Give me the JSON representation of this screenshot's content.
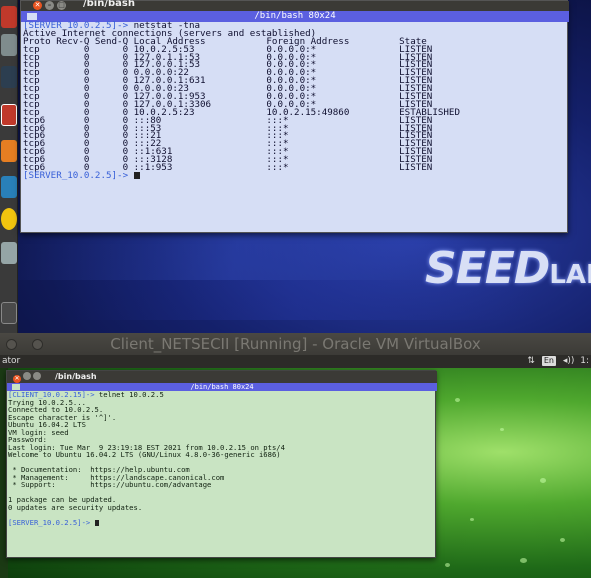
{
  "top_vm": {
    "window_title": "/bin/bash",
    "terminal_title": "/bin/bash 80x24",
    "logo": {
      "main": "SEED",
      "tail": "LAB"
    },
    "lines": [
      {
        "prompt": "[SERVER_10.0.2.5]->",
        "text": " netstat -tna"
      },
      {
        "text": "Active Internet connections (servers and established)"
      },
      {
        "text": "Proto Recv-Q Send-Q Local Address           Foreign Address         State"
      },
      {
        "text": "tcp        0      0 10.0.2.5:53             0.0.0.0:*               LISTEN"
      },
      {
        "text": "tcp        0      0 127.0.1.1:53            0.0.0.0:*               LISTEN"
      },
      {
        "text": "tcp        0      0 127.0.0.1:53            0.0.0.0:*               LISTEN"
      },
      {
        "text": "tcp        0      0 0.0.0.0:22              0.0.0.0:*               LISTEN"
      },
      {
        "text": "tcp        0      0 127.0.0.1:631           0.0.0.0:*               LISTEN"
      },
      {
        "text": "tcp        0      0 0.0.0.0:23              0.0.0.0:*               LISTEN"
      },
      {
        "text": "tcp        0      0 127.0.0.1:953           0.0.0.0:*               LISTEN"
      },
      {
        "text": "tcp        0      0 127.0.0.1:3306          0.0.0.0:*               LISTEN"
      },
      {
        "text": "tcp        0      0 10.0.2.5:23             10.0.2.15:49860         ESTABLISHED"
      },
      {
        "text": "tcp6       0      0 :::80                   :::*                    LISTEN"
      },
      {
        "text": "tcp6       0      0 :::53                   :::*                    LISTEN"
      },
      {
        "text": "tcp6       0      0 :::21                   :::*                    LISTEN"
      },
      {
        "text": "tcp6       0      0 :::22                   :::*                    LISTEN"
      },
      {
        "text": "tcp6       0      0 ::1:631                 :::*                    LISTEN"
      },
      {
        "text": "tcp6       0      0 :::3128                 :::*                    LISTEN"
      },
      {
        "text": "tcp6       0      0 ::1:953                 :::*                    LISTEN"
      },
      {
        "prompt": "[SERVER_10.0.2.5]->",
        "text": " ",
        "cursor": true
      }
    ]
  },
  "vbox": {
    "title": "Client_NETSECII [Running] - Oracle VM VirtualBox"
  },
  "bottom_vm": {
    "panel_left": "ator",
    "panel_keyboard": "En",
    "panel_volume": "◂))",
    "panel_clock": "1:",
    "window_title": "/bin/bash",
    "terminal_title": "/bin/bash 80x24",
    "lines": [
      {
        "prompt": "[CLIENT_10.0.2.15]->",
        "text": " telnet 10.0.2.5"
      },
      {
        "text": "Trying 10.0.2.5..."
      },
      {
        "text": "Connected to 10.0.2.5."
      },
      {
        "text": "Escape character is '^]'."
      },
      {
        "text": "Ubuntu 16.04.2 LTS"
      },
      {
        "text": "VM login: seed"
      },
      {
        "text": "Password:"
      },
      {
        "text": "Last login: Tue Mar  9 23:19:18 EST 2021 from 10.0.2.15 on pts/4"
      },
      {
        "text": "Welcome to Ubuntu 16.04.2 LTS (GNU/Linux 4.8.0-36-generic i686)"
      },
      {
        "text": ""
      },
      {
        "text": " * Documentation:  https://help.ubuntu.com"
      },
      {
        "text": " * Management:     https://landscape.canonical.com"
      },
      {
        "text": " * Support:        https://ubuntu.com/advantage"
      },
      {
        "text": ""
      },
      {
        "text": "1 package can be updated."
      },
      {
        "text": "0 updates are security updates."
      },
      {
        "text": ""
      },
      {
        "prompt": "[SERVER_10.0.2.5]->",
        "text": " ",
        "cursor": true
      }
    ]
  }
}
